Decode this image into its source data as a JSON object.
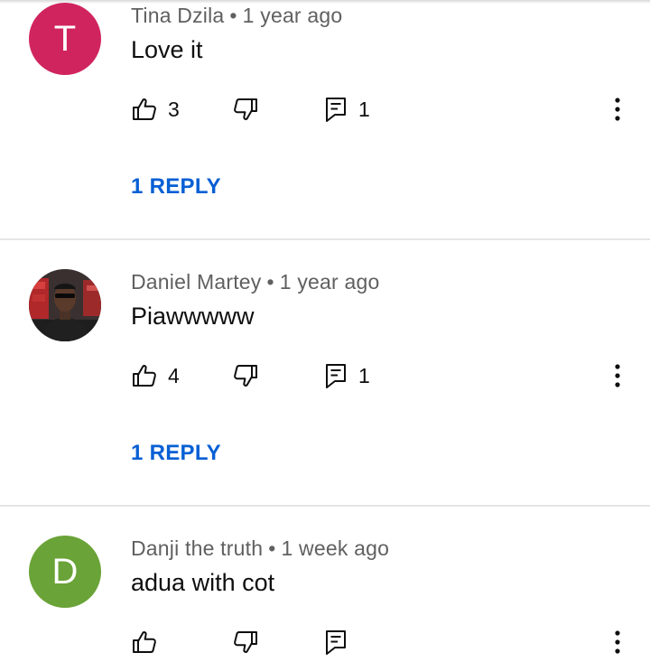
{
  "comments": [
    {
      "author": "Tina Dzila",
      "time": "1 year ago",
      "text": "Love it",
      "avatar_letter": "T",
      "avatar_color": "#d0245f",
      "likes": "3",
      "replies": "1",
      "replies_link": "1 REPLY"
    },
    {
      "author": "Daniel Martey",
      "time": "1 year ago",
      "text": "Piawwwww",
      "avatar_letter": "",
      "avatar_color": "#2b2b2b",
      "likes": "4",
      "replies": "1",
      "replies_link": "1 REPLY"
    },
    {
      "author": "Danji the truth",
      "time": "1 week ago",
      "text": "adua with cot",
      "avatar_letter": "D",
      "avatar_color": "#6aa337",
      "likes": "",
      "replies": "",
      "replies_link": ""
    }
  ],
  "colors": {
    "link": "#065fd4",
    "meta_text": "#606060",
    "divider": "#e5e5e5"
  },
  "icons": {
    "like": "thumbs-up-icon",
    "dislike": "thumbs-down-icon",
    "reply": "comment-icon",
    "more": "more-vertical-icon"
  }
}
